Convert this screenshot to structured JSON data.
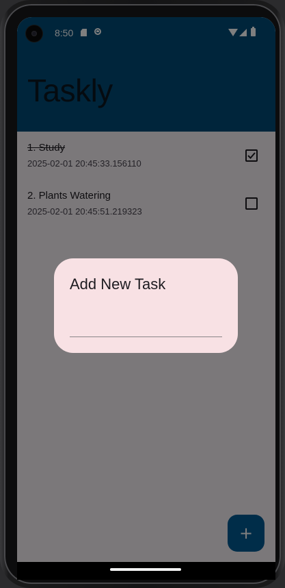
{
  "status_bar": {
    "time": "8:50",
    "icons": [
      "camera-icon",
      "sd-card-icon",
      "face-icon",
      "wifi-icon",
      "signal-icon",
      "battery-icon"
    ]
  },
  "app_bar": {
    "title": "Taskly",
    "color": "#004a77"
  },
  "tasks": [
    {
      "title": "1. Study",
      "timestamp": "2025-02-01 20:45:33.156110",
      "checked": true
    },
    {
      "title": "2. Plants Watering",
      "timestamp": "2025-02-01 20:45:51.219323",
      "checked": false
    }
  ],
  "dialog": {
    "title": "Add New Task",
    "input_value": "",
    "background": "#f8e1e4"
  },
  "fab": {
    "icon": "plus-icon",
    "label": "+",
    "color": "#005a93"
  }
}
